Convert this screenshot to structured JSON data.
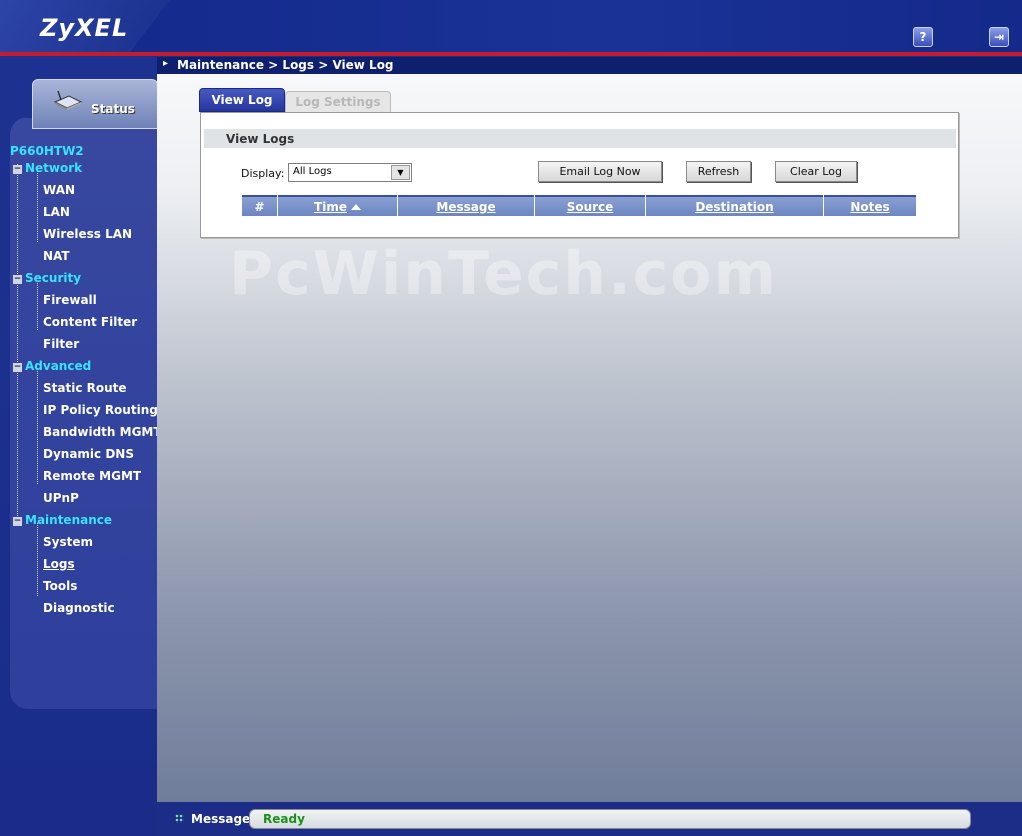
{
  "brand": {
    "logo": "ZyXEL"
  },
  "icons": {
    "help": "help-icon",
    "logout": "logout-icon"
  },
  "breadcrumb": "Maintenance > Logs > View Log",
  "sidebar": {
    "status_label": "Status",
    "device": "P660HTW2",
    "groups": [
      {
        "label": "Network",
        "items": [
          "WAN",
          "LAN",
          "Wireless LAN",
          "NAT"
        ]
      },
      {
        "label": "Security",
        "items": [
          "Firewall",
          "Content Filter",
          "Filter"
        ]
      },
      {
        "label": "Advanced",
        "items": [
          "Static Route",
          "IP Policy Routing",
          "Bandwidth MGMT",
          "Dynamic DNS",
          "Remote MGMT",
          "UPnP"
        ]
      },
      {
        "label": "Maintenance",
        "items": [
          "System",
          "Logs",
          "Tools",
          "Diagnostic"
        ]
      }
    ],
    "active_item": "Logs"
  },
  "tabs": [
    {
      "label": "View Log",
      "active": true
    },
    {
      "label": "Log Settings",
      "active": false
    }
  ],
  "panel": {
    "title": "View Logs",
    "display_label": "Display:",
    "display_value": "All Logs",
    "buttons": {
      "email": "Email Log Now",
      "refresh": "Refresh",
      "clear": "Clear Log"
    },
    "columns": [
      "#",
      "Time",
      "Message",
      "Source",
      "Destination",
      "Notes"
    ],
    "rows": []
  },
  "watermark": "PcWinTech.com",
  "status": {
    "label": "Message",
    "value": "Ready"
  },
  "colors": {
    "accent": "#1a2f8c",
    "nav_group": "#37e3ff",
    "status_ok": "#1c8f1c",
    "redline": "#c41c2c"
  }
}
